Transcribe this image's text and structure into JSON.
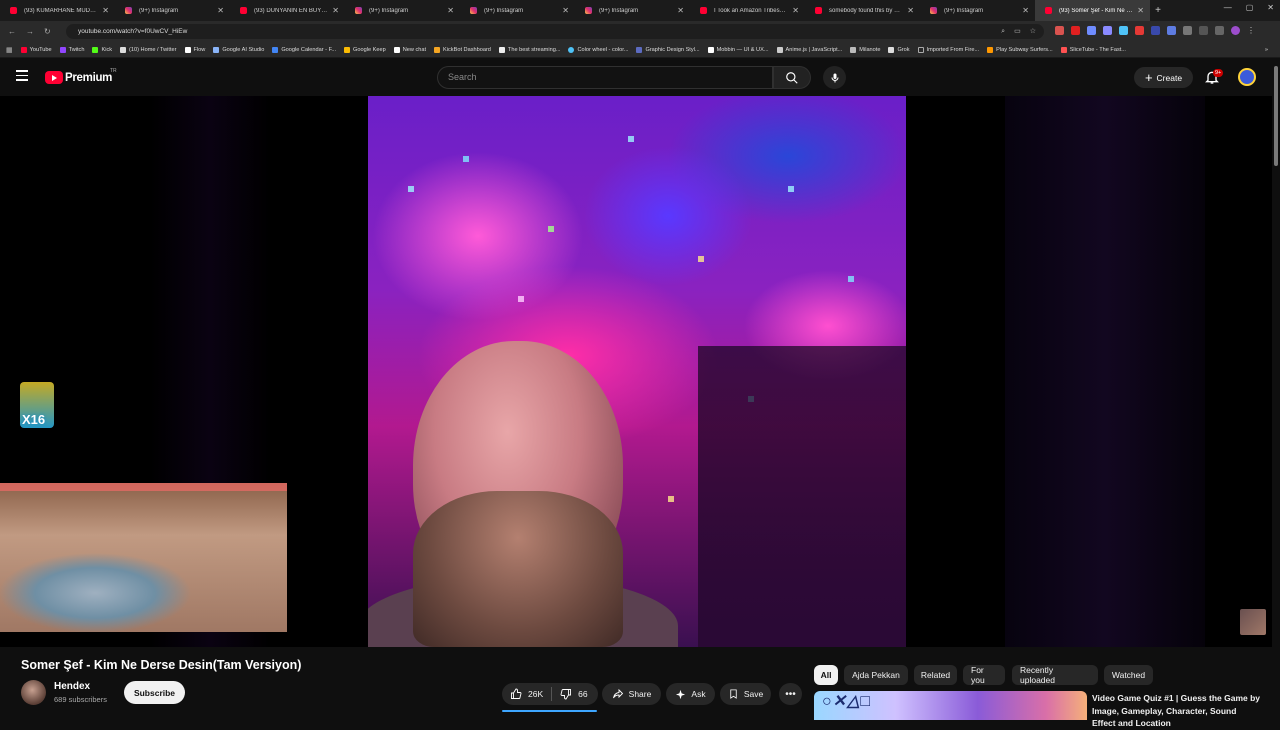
{
  "browser": {
    "tabs": [
      {
        "label": "(93) KUMARHANE MÜDÜRÜ...",
        "favicon": "youtube-icon",
        "active": false
      },
      {
        "label": "(9+) Instagram",
        "favicon": "instagram-icon",
        "active": false
      },
      {
        "label": "(93) DÜNYANIN EN BÜYÜK T...",
        "favicon": "youtube-icon",
        "active": false
      },
      {
        "label": "(9+) Instagram",
        "favicon": "instagram-icon",
        "active": false
      },
      {
        "label": "(9+) Instagram",
        "favicon": "instagram-icon",
        "active": false
      },
      {
        "label": "(9+) Instagram",
        "favicon": "instagram-icon",
        "active": false
      },
      {
        "label": "I Took an Amazon Tribesman...",
        "favicon": "youtube-icon",
        "active": false
      },
      {
        "label": "somebody found this by acci...",
        "favicon": "youtube-icon",
        "active": false
      },
      {
        "label": "(9+) Instagram",
        "favicon": "instagram-icon",
        "active": false
      },
      {
        "label": "(93) Somer Şef - Kim Ne D...",
        "favicon": "youtube-icon",
        "active": true
      }
    ],
    "url": "youtube.com/watch?v=f0UwCV_HiEw",
    "bookmarks": [
      {
        "label": "YouTube",
        "color": "#ff0033"
      },
      {
        "label": "Twitch",
        "color": "#9146ff"
      },
      {
        "label": "Kick",
        "color": "#53fc18"
      },
      {
        "label": "(10) Home / Twitter",
        "color": "#dddddd"
      },
      {
        "label": "Flow",
        "color": "#ffffff"
      },
      {
        "label": "Google AI Studio",
        "color": "#8ab4f8"
      },
      {
        "label": "Google Calendar - F...",
        "color": "#4285f4"
      },
      {
        "label": "Google Keep",
        "color": "#fbbc04"
      },
      {
        "label": "New chat",
        "color": "#ffffff"
      },
      {
        "label": "KickBot Dashboard",
        "color": "#f5a623"
      },
      {
        "label": "The best streaming...",
        "color": "#eeeeee"
      },
      {
        "label": "Color wheel - color...",
        "color": "#4fc3f7"
      },
      {
        "label": "Graphic Design Styl...",
        "color": "#5c6bc0"
      },
      {
        "label": "Mobbin — UI & UX...",
        "color": "#ffffff"
      },
      {
        "label": "Anime.js | JavaScript...",
        "color": "#cccccc"
      },
      {
        "label": "Milanote",
        "color": "#bbbbbb"
      },
      {
        "label": "Grok",
        "color": "#dddddd"
      },
      {
        "label": "Imported From Fire...",
        "color": "#aaaaaa"
      },
      {
        "label": "Play Subway Surfers...",
        "color": "#ff9800"
      },
      {
        "label": "SliceTube - The Fast...",
        "color": "#ff5252"
      }
    ]
  },
  "header": {
    "logo_text": "Premium",
    "country": "TR",
    "search_placeholder": "Search",
    "create_label": "Create",
    "notification_count": "9+"
  },
  "video": {
    "title": "Somer Şef - Kim Ne Derse Desin(Tam Versiyon)",
    "overlay_sticker_text": "X16",
    "channel": {
      "name": "Hendex",
      "subscribers": "689 subscribers",
      "subscribe_label": "Subscribe"
    },
    "actions": {
      "likes": "26K",
      "dislikes": "66",
      "share": "Share",
      "ask": "Ask",
      "save": "Save"
    }
  },
  "filters": {
    "chips": [
      {
        "label": "All",
        "active": true
      },
      {
        "label": "Ajda Pekkan",
        "active": false
      },
      {
        "label": "Related",
        "active": false
      },
      {
        "label": "For you",
        "active": false
      },
      {
        "label": "Recently uploaded",
        "active": false
      },
      {
        "label": "Watched",
        "active": false
      }
    ]
  },
  "recommendation": {
    "title": "Video Game Quiz #1 | Guess the Game by Image, Gameplay, Character, Sound Effect and Location"
  },
  "colors": {
    "background": "#0f0f0f",
    "brand": "#ff0033",
    "accent": "#3ea6ff"
  }
}
